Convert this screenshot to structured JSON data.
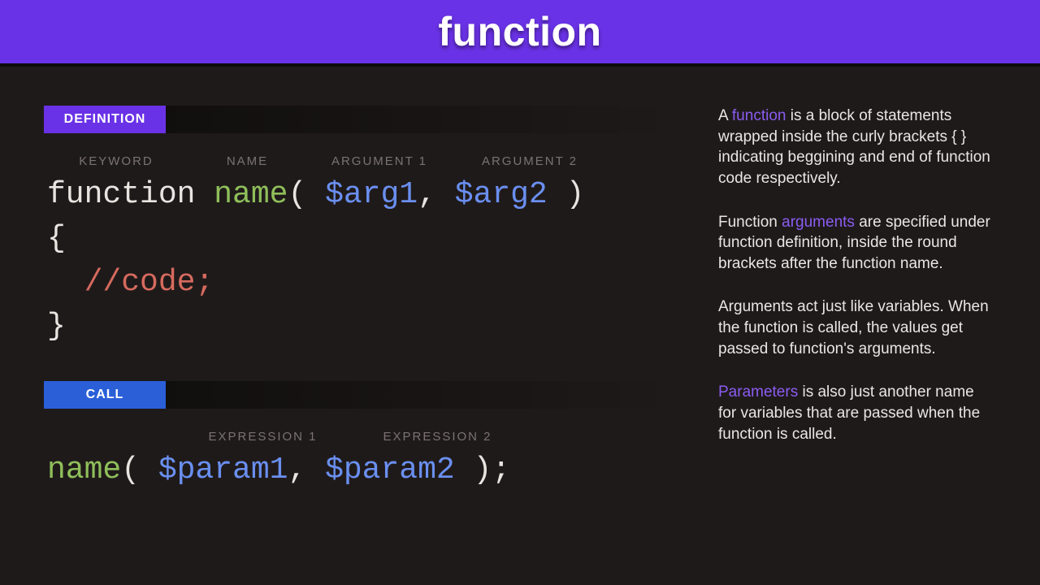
{
  "header": {
    "title": "function"
  },
  "tabs": {
    "definition": "DEFINITION",
    "call": "CALL"
  },
  "annotations": {
    "definition": [
      "KEYWORD",
      "NAME",
      "ARGUMENT 1",
      "ARGUMENT 2"
    ],
    "call": [
      "EXPRESSION 1",
      "EXPRESSION 2"
    ]
  },
  "code": {
    "def": {
      "keyword": "function",
      "name": "name",
      "open": "( ",
      "arg1": "$arg1",
      "comma": ", ",
      "arg2": "$arg2",
      "close": " )",
      "brace_open": "{",
      "comment": "//code;",
      "indent": "  ",
      "brace_close": "}"
    },
    "call": {
      "name": "name",
      "open": "( ",
      "param1": "$param1",
      "comma": ", ",
      "param2": "$param2",
      "close": " );"
    }
  },
  "desc": {
    "p1_a": "A ",
    "p1_hl": "function",
    "p1_b": " is a block of statements wrapped inside the curly brackets {  } indicating beggining and end of function code respectively.",
    "p2_a": "Function ",
    "p2_hl": "arguments",
    "p2_b": " are specified under function definition, inside the round brackets after the function name.",
    "p3": "Arguments act just like variables. When the function is called, the values get passed to function's arguments.",
    "p4_hl": "Parameters",
    "p4_b": " is also just another name for variables that are passed when the function is called."
  }
}
